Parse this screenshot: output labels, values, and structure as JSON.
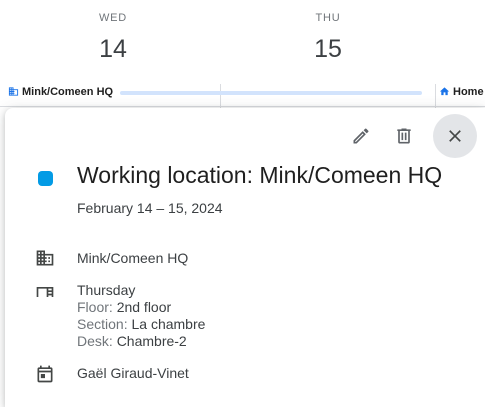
{
  "calendar": {
    "days": [
      {
        "name": "WED",
        "number": "14"
      },
      {
        "name": "THU",
        "number": "15"
      }
    ],
    "chips": [
      {
        "label": "Mink/Comeen HQ",
        "icon": "building-icon"
      },
      {
        "label": "Home",
        "icon": "home-icon"
      }
    ]
  },
  "event": {
    "title": "Working location: Mink/Comeen HQ",
    "dates": "February 14 – 15, 2024",
    "color": "#039be5",
    "location": "Mink/Comeen HQ",
    "desk_block": {
      "day": "Thursday",
      "floor_label": "Floor:",
      "floor_value": "2nd floor",
      "section_label": "Section:",
      "section_value": "La chambre",
      "desk_label": "Desk:",
      "desk_value": "Chambre-2"
    },
    "calendar_owner": "Gaël Giraud-Vinet"
  },
  "toolbar": {
    "edit_icon": "pencil-icon",
    "delete_icon": "trash-icon",
    "close_icon": "close-icon"
  }
}
